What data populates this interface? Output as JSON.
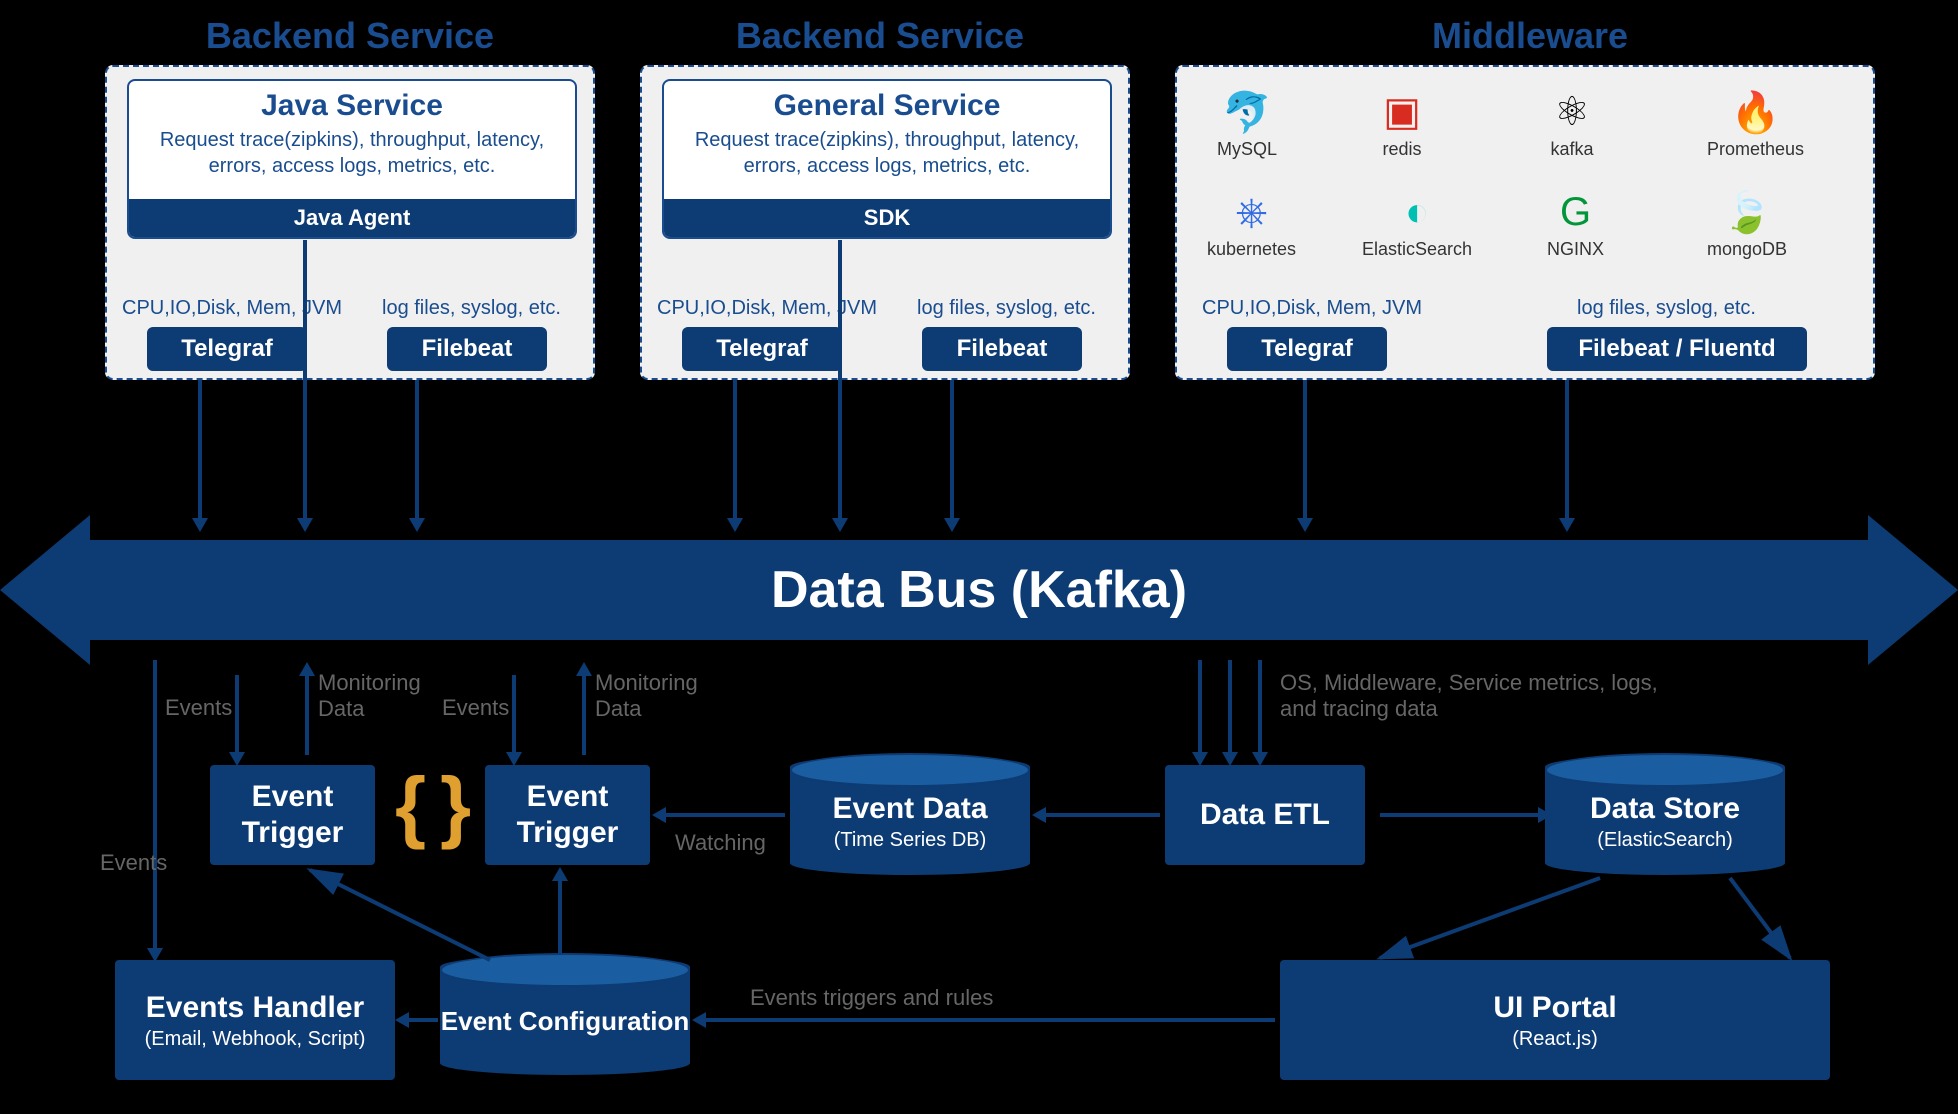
{
  "sections": {
    "backend1": "Backend Service",
    "backend2": "Backend Service",
    "middleware": "Middleware"
  },
  "java": {
    "title": "Java Service",
    "desc": "Request trace(zipkins), throughput, latency, errors, access logs, metrics, etc.",
    "agent": "Java Agent",
    "metrics_label": "CPU,IO,Disk, Mem, JVM",
    "logs_label": "log files, syslog, etc.",
    "telegraf": "Telegraf",
    "filebeat": "Filebeat"
  },
  "general": {
    "title": "General Service",
    "desc": "Request trace(zipkins), throughput, latency, errors, access logs, metrics, etc.",
    "sdk": "SDK",
    "metrics_label": "CPU,IO,Disk, Mem, JVM",
    "logs_label": "log files, syslog, etc.",
    "telegraf": "Telegraf",
    "filebeat": "Filebeat"
  },
  "middleware": {
    "logos": [
      "MySQL",
      "redis",
      "kafka",
      "Prometheus",
      "kubernetes",
      "ElasticSearch",
      "NGINX",
      "mongoDB"
    ],
    "metrics_label": "CPU,IO,Disk, Mem, JVM",
    "logs_label": "log files,  syslog, etc.",
    "telegraf": "Telegraf",
    "filebeat": "Filebeat / Fluentd"
  },
  "bus": {
    "label": "Data Bus (Kafka)"
  },
  "flow": {
    "events": "Events",
    "monitoring": "Monitoring Data",
    "watching": "Watching",
    "os_metrics": "OS, Middleware, Service metrics, logs, and tracing data",
    "triggers_rules": "Events triggers and rules"
  },
  "nodes": {
    "event_trigger": "Event Trigger",
    "event_data": {
      "title": "Event Data",
      "sub": "(Time Series DB)"
    },
    "data_etl": "Data ETL",
    "data_store": {
      "title": "Data Store",
      "sub": "(ElasticSearch)"
    },
    "events_handler": {
      "title": "Events Handler",
      "sub": "(Email, Webhook, Script)"
    },
    "event_config": "Event Configuration",
    "ui_portal": {
      "title": "UI Portal",
      "sub": "(React.js)"
    }
  }
}
